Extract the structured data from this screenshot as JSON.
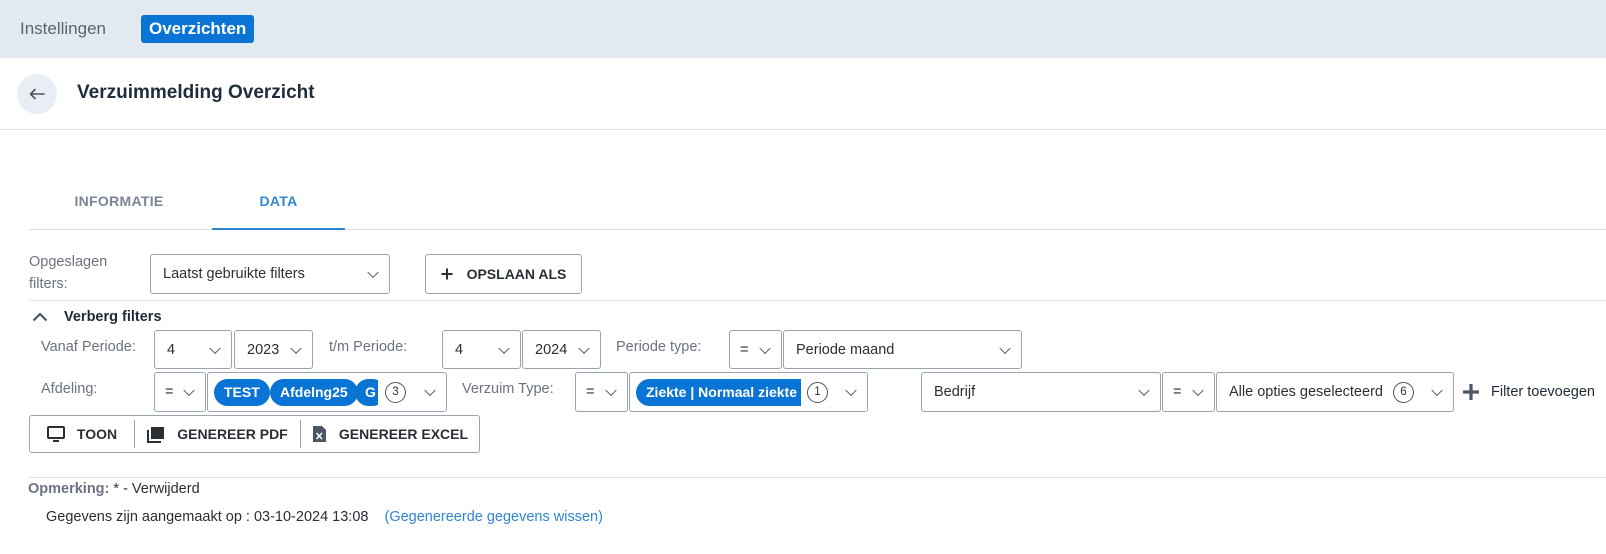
{
  "topnav": {
    "tabs": [
      "Instellingen",
      "Overzichten"
    ]
  },
  "header": {
    "title": "Verzuimmelding Overzicht"
  },
  "tabs": {
    "info": "INFORMATIE",
    "data": "DATA"
  },
  "saved": {
    "label": "Opgeslagen filters:",
    "value": "Laatst gebruikte filters",
    "save_as": "OPSLAAN ALS"
  },
  "toggle": {
    "label": "Verberg filters"
  },
  "row1": {
    "vanaf_label": "Vanaf Periode:",
    "vanaf_period": "4",
    "vanaf_year": "2023",
    "tm_label": "t/m Periode:",
    "tm_period": "4",
    "tm_year": "2024",
    "type_label": "Periode type:",
    "type_op": "=",
    "type_value": "Periode maand"
  },
  "row2": {
    "afdeling_label": "Afdeling:",
    "afdeling_op": "=",
    "afdeling_chips": [
      "TEST",
      "Afdelng25",
      "G"
    ],
    "afdeling_count": "3",
    "verzuim_label": "Verzuim Type:",
    "verzuim_op": "=",
    "verzuim_chip": "Ziekte | Normaal ziekte g",
    "verzuim_count": "1",
    "bedrijf_field": "Bedrijf",
    "bedrijf_op": "=",
    "bedrijf_value": "Alle opties geselecteerd",
    "bedrijf_count": "6",
    "add_filter": "Filter toevoegen"
  },
  "actions": {
    "toon": "TOON",
    "pdf": "GENEREER PDF",
    "excel": "GENEREER EXCEL"
  },
  "footer": {
    "remark_label": "Opmerking:",
    "remark_text": "* - Verwijderd",
    "created": "Gegevens zijn aangemaakt op : 03-10-2024 13:08",
    "clear_link": "(Gegenereerde gegevens wissen)"
  },
  "colors": {
    "accent": "#0a74d4",
    "link": "#2f86d3"
  }
}
